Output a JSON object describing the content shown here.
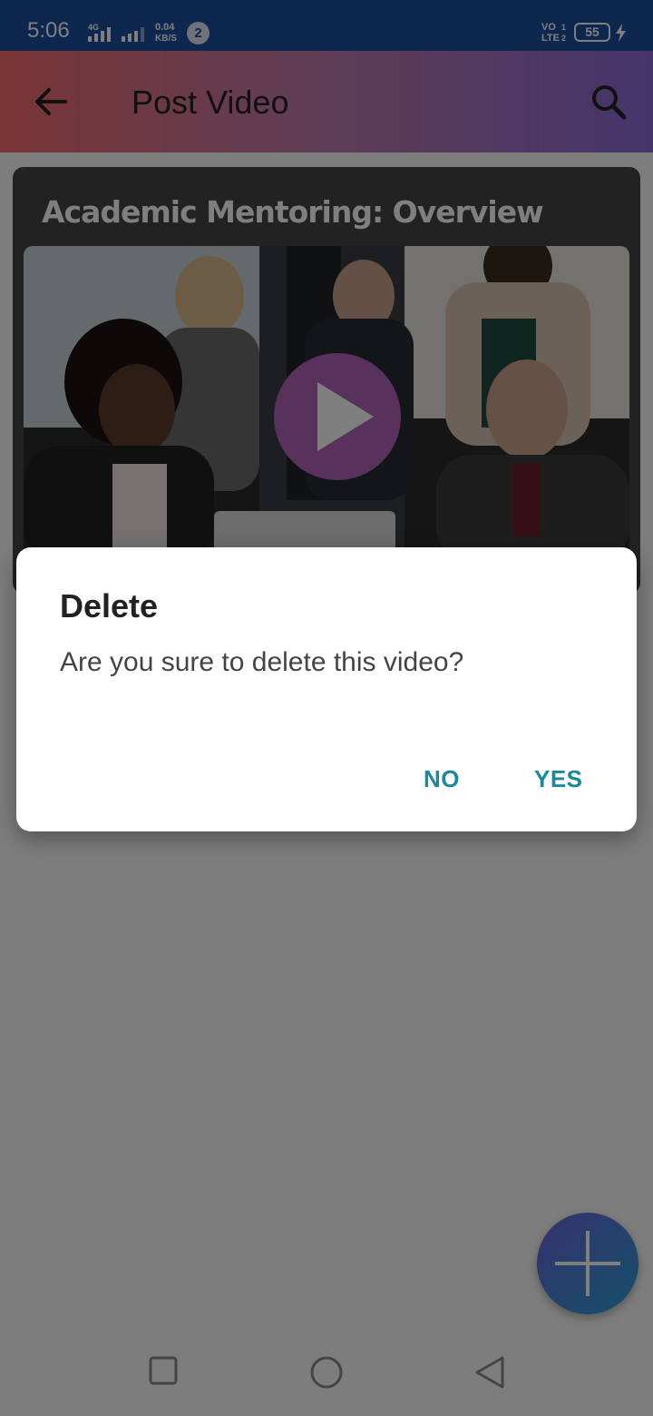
{
  "status_bar": {
    "time": "5:06",
    "network_type": "4G",
    "data_speed_value": "0.04",
    "data_speed_unit": "KB/S",
    "notification_count": "2",
    "volte_top": "VO",
    "volte_bottom": "LTE",
    "sim1": "1",
    "sim2": "2",
    "battery_level": "55"
  },
  "app_bar": {
    "title": "Post Video",
    "back_icon": "arrow-back-icon",
    "search_icon": "search-icon"
  },
  "video_card": {
    "title": "Academic Mentoring: Overview",
    "play_icon": "play-icon"
  },
  "fab": {
    "icon": "plus-icon"
  },
  "dialog": {
    "title": "Delete",
    "message": "Are you sure to delete this video?",
    "no_label": "NO",
    "yes_label": "YES"
  },
  "nav_bar": {
    "recents_icon": "square-icon",
    "home_icon": "circle-icon",
    "back_icon": "triangle-back-icon"
  },
  "colors": {
    "status_bar": "#1a4f9c",
    "dialog_button": "#1a8a9a",
    "play_button": "#b162b9"
  }
}
